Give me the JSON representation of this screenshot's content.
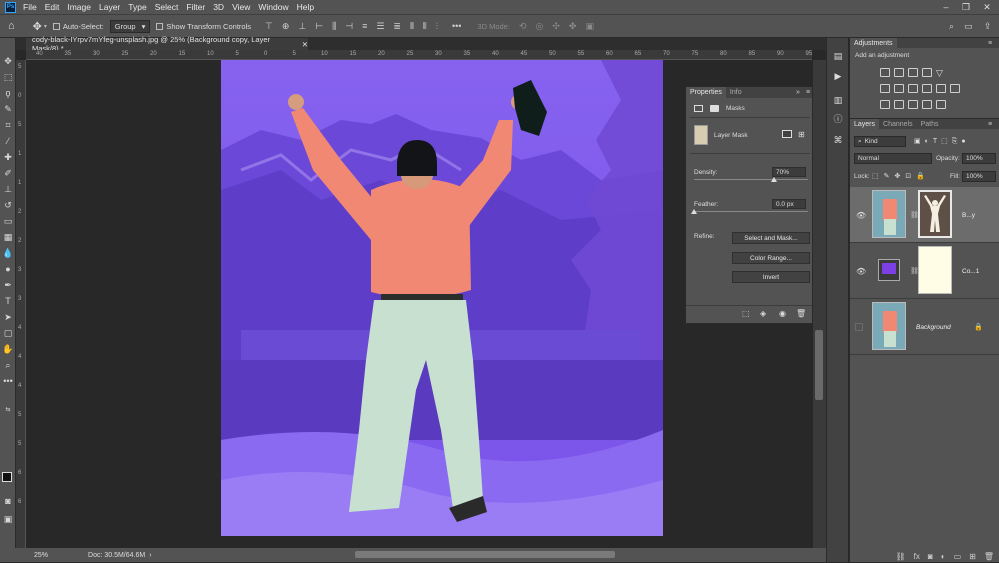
{
  "menu": {
    "items": [
      "File",
      "Edit",
      "Image",
      "Layer",
      "Type",
      "Select",
      "Filter",
      "3D",
      "View",
      "Window",
      "Help"
    ]
  },
  "options": {
    "auto_select_label": "Auto-Select:",
    "group_value": "Group",
    "transform_label": "Show Transform Controls",
    "mode_3d": "3D Mode:"
  },
  "document": {
    "tab_title": "cody-black-IYrpv7mYfeg-unsplash.jpg @ 25% (Background copy, Layer Mask/8) *",
    "zoom": "25%",
    "doc_size": "Doc: 30.5M/64.6M"
  },
  "ruler": {
    "h_ticks": [
      "40",
      "35",
      "30",
      "25",
      "20",
      "15",
      "10",
      "5",
      "0",
      "5",
      "10",
      "15",
      "20",
      "25",
      "30",
      "35",
      "40",
      "45",
      "50",
      "55",
      "60",
      "65",
      "70",
      "75",
      "80",
      "85",
      "90",
      "95"
    ],
    "v_ticks": [
      "5",
      "0",
      "5",
      "1",
      "1",
      "2",
      "2",
      "3",
      "3",
      "4",
      "4",
      "4",
      "5",
      "5",
      "6",
      "6"
    ]
  },
  "properties": {
    "tab_properties": "Properties",
    "tab_info": "Info",
    "section": "Masks",
    "mask_type": "Layer Mask",
    "density_label": "Density:",
    "density_value": "70%",
    "density": 0.7,
    "feather_label": "Feather:",
    "feather_value": "0.0 px",
    "feather": 0,
    "refine_label": "Refine:",
    "btn_select_mask": "Select and Mask...",
    "btn_color_range": "Color Range...",
    "btn_invert": "Invert"
  },
  "adjustments": {
    "title": "Adjustments",
    "subtitle": "Add an adjustment"
  },
  "layers": {
    "tab_layers": "Layers",
    "tab_channels": "Channels",
    "tab_paths": "Paths",
    "kind": "Kind",
    "blend_mode": "Normal",
    "opacity_label": "Opacity:",
    "opacity_value": "100%",
    "lock_label": "Lock:",
    "fill_label": "Fill:",
    "fill_value": "100%",
    "rows": [
      {
        "name": "B...y"
      },
      {
        "name": "Co...1",
        "fill_color": "#7b3fe4"
      },
      {
        "name": "Background"
      }
    ]
  },
  "colors": {
    "overlay": "#7a4ff0",
    "sweater": "#f08873",
    "pants": "#c8e0cf",
    "mask_bg": "#fffde6"
  }
}
